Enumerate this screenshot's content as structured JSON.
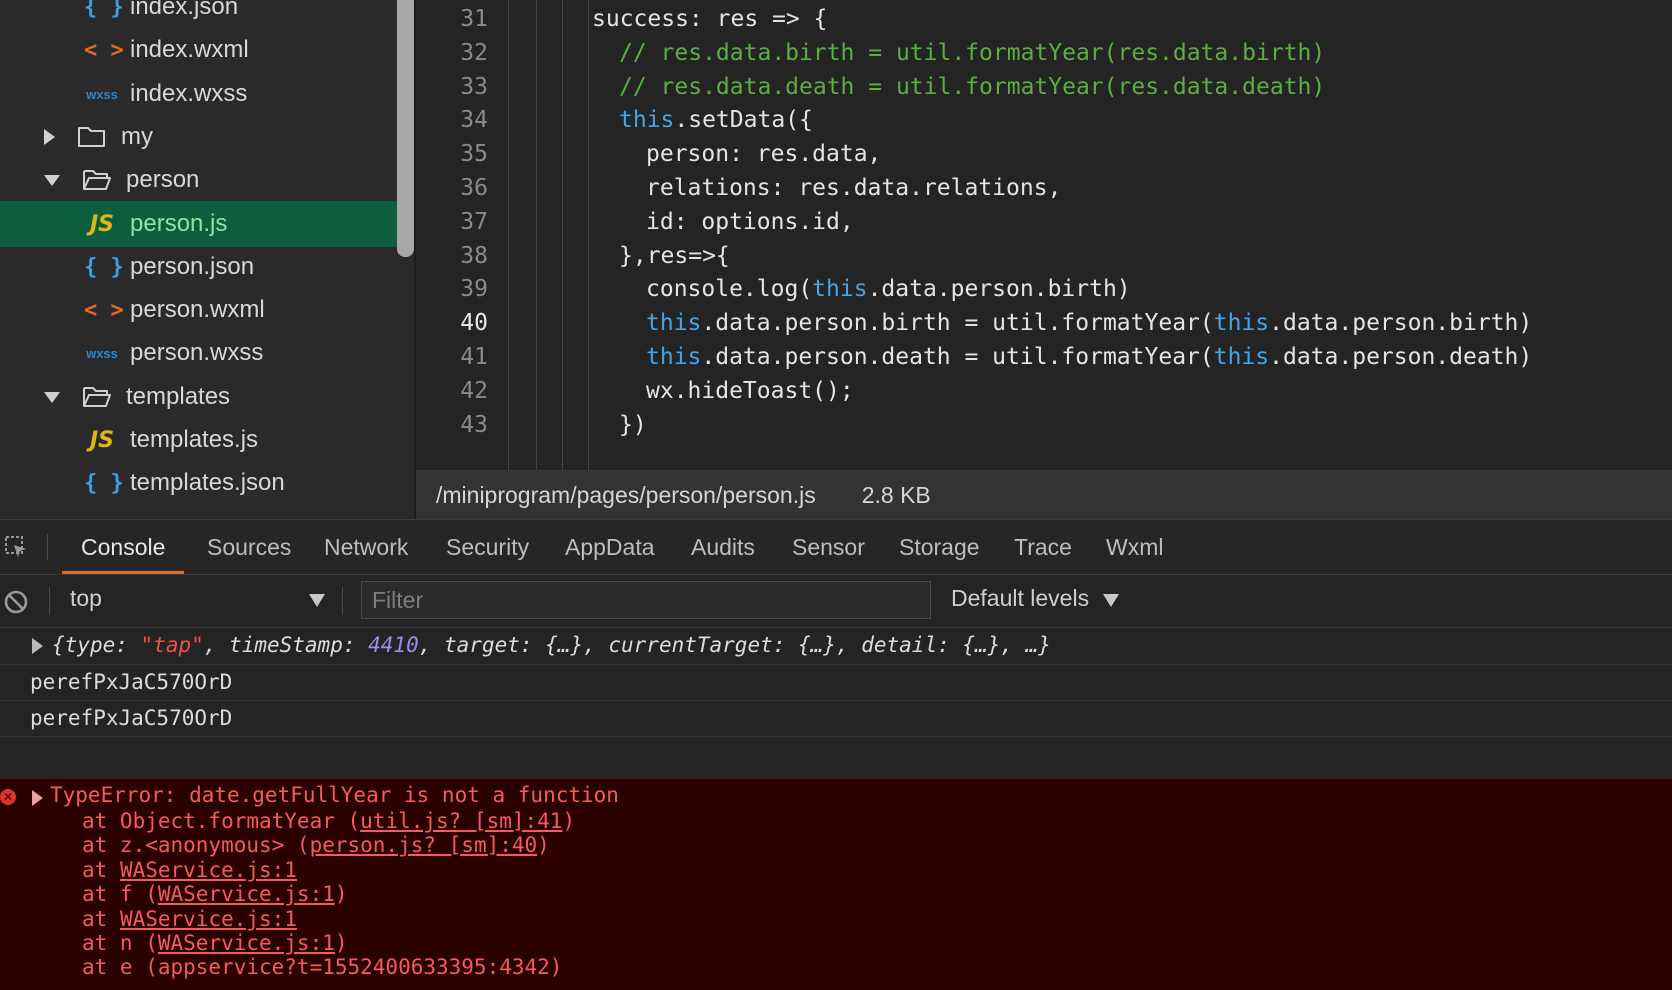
{
  "tree": {
    "items": [
      {
        "label": "index.json",
        "icon": "{ }",
        "type": "json"
      },
      {
        "label": "index.wxml",
        "icon": "< >",
        "type": "wxml"
      },
      {
        "label": "index.wxss",
        "icon": "wxss",
        "type": "wxss"
      },
      {
        "label": "my",
        "type": "folder-closed"
      },
      {
        "label": "person",
        "type": "folder-open"
      },
      {
        "label": "person.js",
        "icon": "JS",
        "type": "js",
        "selected": true
      },
      {
        "label": "person.json",
        "icon": "{ }",
        "type": "json"
      },
      {
        "label": "person.wxml",
        "icon": "< >",
        "type": "wxml"
      },
      {
        "label": "person.wxss",
        "icon": "wxss",
        "type": "wxss"
      },
      {
        "label": "templates",
        "type": "folder-open"
      },
      {
        "label": "templates.js",
        "icon": "JS",
        "type": "js"
      },
      {
        "label": "templates.json",
        "icon": "{ }",
        "type": "json"
      }
    ]
  },
  "editor": {
    "active_line": 40,
    "lines": [
      {
        "n": "31",
        "code": "success: res => {"
      },
      {
        "n": "32",
        "code": "// res.data.birth = util.formatYear(res.data.birth)"
      },
      {
        "n": "33",
        "code": "// res.data.death = util.formatYear(res.data.death)"
      },
      {
        "n": "34",
        "code": "this.setData({"
      },
      {
        "n": "35",
        "code": "person: res.data,"
      },
      {
        "n": "36",
        "code": "relations: res.data.relations,"
      },
      {
        "n": "37",
        "code": "id: options.id,"
      },
      {
        "n": "38",
        "code": "},res=>{"
      },
      {
        "n": "39",
        "code": "console.log(this.data.person.birth)"
      },
      {
        "n": "40",
        "code": "this.data.person.birth = util.formatYear(this.data.person.birth)"
      },
      {
        "n": "41",
        "code": "this.data.person.death = util.formatYear(this.data.person.death)"
      },
      {
        "n": "42",
        "code": "wx.hideToast();"
      },
      {
        "n": "43",
        "code": "})"
      }
    ]
  },
  "status": {
    "path": "/miniprogram/pages/person/person.js",
    "size": "2.8 KB"
  },
  "devtools": {
    "tabs": [
      "Console",
      "Sources",
      "Network",
      "Security",
      "AppData",
      "Audits",
      "Sensor",
      "Storage",
      "Trace",
      "Wxml"
    ],
    "active_tab": "Console",
    "context": "top",
    "filter_placeholder": "Filter",
    "levels": "Default levels"
  },
  "console": {
    "obj_log": {
      "open": "{",
      "k1": "type",
      "v1": "\"tap\"",
      "k2": "timeStamp",
      "v2": "4410",
      "rest": "target: {…}, currentTarget: {…}, detail: {…}, …}"
    },
    "logs": [
      "perefPxJaC570OrD",
      "perefPxJaC570OrD"
    ],
    "error": {
      "message": "TypeError: date.getFullYear is not a function",
      "stack": [
        {
          "prefix": "at Object.formatYear (",
          "link": "util.js? [sm]:41",
          "suffix": ")"
        },
        {
          "prefix": "at z.<anonymous> (",
          "link": "person.js? [sm]:40",
          "suffix": ")"
        },
        {
          "prefix": "at ",
          "link": "WAService.js:1",
          "suffix": ""
        },
        {
          "prefix": "at f (",
          "link": "WAService.js:1",
          "suffix": ")"
        },
        {
          "prefix": "at ",
          "link": "WAService.js:1",
          "suffix": ""
        },
        {
          "prefix": "at n (",
          "link": "WAService.js:1",
          "suffix": ")"
        },
        {
          "prefix": "at e (appservice?t=1552400633395:4342)",
          "link": "",
          "suffix": ""
        }
      ]
    }
  }
}
